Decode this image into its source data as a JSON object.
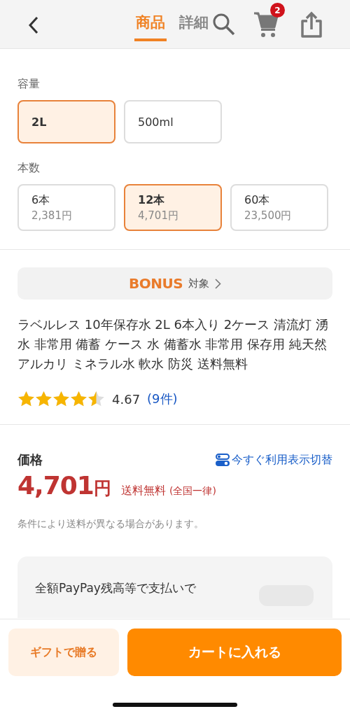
{
  "header": {
    "tabs": [
      {
        "label": "商品",
        "selected": true
      },
      {
        "label": "詳細",
        "selected": false
      }
    ],
    "cart_count": "2"
  },
  "option_groups": [
    {
      "label": "容量",
      "options": [
        {
          "name": "2L",
          "selected": true
        },
        {
          "name": "500ml",
          "selected": false
        }
      ]
    },
    {
      "label": "本数",
      "options": [
        {
          "name": "6本",
          "price": "2,381円",
          "selected": false
        },
        {
          "name": "12本",
          "price": "4,701円",
          "selected": true
        },
        {
          "name": "60本",
          "price": "23,500円",
          "selected": false
        }
      ]
    }
  ],
  "bonus": {
    "logo": "BONUS",
    "label": "対象"
  },
  "product_title": "ラベルレス 10年保存水 2L 6本入り 2ケース 清流灯 湧水 非常用 備蓄 ケース 水 備蓄水 非常用 保存用 純天然アルカリ ミネラル水 軟水 防災 送料無料",
  "rating": {
    "stars": 4.5,
    "score": "4.67",
    "count": "(9件)"
  },
  "price": {
    "label": "価格",
    "toggle_link": "今すぐ利用表示切替",
    "amount": "4,701",
    "currency": "円",
    "shipping": "送料無料",
    "shipping_note": "(全国一律)",
    "note": "条件により送料が異なる場合があります。"
  },
  "paypay_card": {
    "text": "全額PayPay残高等で支払いで"
  },
  "actions": [
    {
      "kind": "secondary",
      "label": "ギフトで贈る"
    },
    {
      "kind": "primary",
      "label": "カートに入れる"
    }
  ]
}
